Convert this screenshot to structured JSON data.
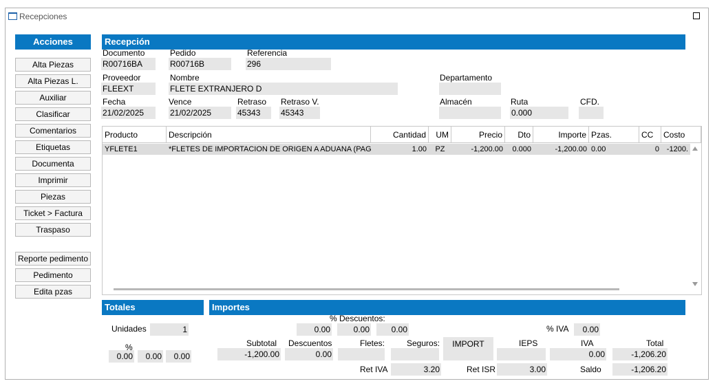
{
  "window": {
    "title": "Recepciones"
  },
  "actions": {
    "header": "Acciones",
    "buttons": [
      "Alta Piezas",
      "Alta Piezas L.",
      "Auxiliar",
      "Clasificar",
      "Comentarios",
      "Etiquetas",
      "Documenta",
      "Imprimir",
      "Piezas",
      "Ticket > Factura",
      "Traspaso"
    ],
    "buttons2": [
      "Reporte pedimento",
      "Pedimento",
      "Edita pzas"
    ]
  },
  "reception": {
    "header": "Recepción",
    "documento": {
      "label": "Documento",
      "value": "R00716BA"
    },
    "pedido": {
      "label": "Pedido",
      "value": "R00716B"
    },
    "referencia": {
      "label": "Referencia",
      "value": "296"
    },
    "proveedor": {
      "label": "Proveedor",
      "value": "FLEEXT"
    },
    "nombre": {
      "label": "Nombre",
      "value": "FLETE EXTRANJERO D"
    },
    "departamento": {
      "label": "Departamento",
      "value": ""
    },
    "fecha": {
      "label": "Fecha",
      "value": "21/02/2025"
    },
    "vence": {
      "label": "Vence",
      "value": "21/02/2025"
    },
    "retraso": {
      "label": "Retraso",
      "value": "45343"
    },
    "retraso_v": {
      "label": "Retraso V.",
      "value": "45343"
    },
    "almacen": {
      "label": "Almacén",
      "value": ""
    },
    "ruta": {
      "label": "Ruta",
      "value": "0.000"
    },
    "cfd": {
      "label": "CFD.",
      "value": ""
    }
  },
  "grid": {
    "columns": [
      "Producto",
      "Descripción",
      "Cantidad",
      "UM",
      "Precio",
      "Dto",
      "Importe",
      "Pzas.",
      "CC",
      "Costo"
    ],
    "rows": [
      [
        "YFLETE1",
        "*FLETES DE IMPORTACION DE ORIGEN A ADUANA (PAGA",
        "1.00",
        "PZ",
        "-1,200.00",
        "0.000",
        "-1,200.00",
        "0.00",
        "0",
        "-1200."
      ]
    ]
  },
  "totales": {
    "header": "Totales",
    "unidades_label": "Unidades",
    "unidades_value": "1",
    "pct_label": "%",
    "pct_values": [
      "0.00",
      "0.00",
      "0.00"
    ]
  },
  "importes": {
    "header": "Importes",
    "descuentos_pct_label": "% Descuentos:",
    "descuentos_pct_values": [
      "0.00",
      "0.00",
      "0.00"
    ],
    "iva_pct_label": "% IVA",
    "iva_pct_value": "0.00",
    "subtotal": {
      "label": "Subtotal",
      "value": "-1,200.00"
    },
    "descuentos": {
      "label": "Descuentos",
      "value": "0.00"
    },
    "fletes": {
      "label": "Fletes:",
      "value": ""
    },
    "seguros": {
      "label": "Seguros:",
      "value": ""
    },
    "import": {
      "label": "IMPORT",
      "value": ""
    },
    "ieps": {
      "label": "IEPS",
      "value": ""
    },
    "iva": {
      "label": "IVA",
      "value": "0.00"
    },
    "total": {
      "label": "Total",
      "value": "-1,206.20"
    },
    "ret_iva": {
      "label": "Ret IVA",
      "value": "3.20"
    },
    "ret_isr": {
      "label": "Ret ISR",
      "value": "3.00"
    },
    "saldo": {
      "label": "Saldo",
      "value": "-1,206.20"
    }
  }
}
